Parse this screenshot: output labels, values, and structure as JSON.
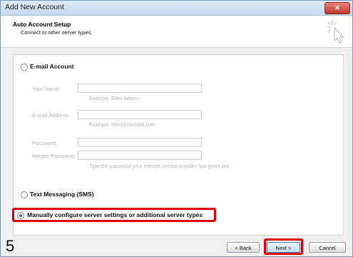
{
  "window": {
    "title": "Add New Account",
    "close_label": "✕"
  },
  "header": {
    "title": "Auto Account Setup",
    "subtitle": "Connect to other server types.",
    "icon": "wizard-cursor-icon"
  },
  "email_account": {
    "label": "E-mail Account",
    "name_label": "Your Name:",
    "name_hint": "Example: Ellen Adams",
    "email_label": "E-mail Address:",
    "email_hint": "Example: ellen@contoso.com",
    "password_label": "Password:",
    "retype_label": "Retype Password:",
    "password_hint": "Type the password your Internet service provider has given you."
  },
  "sms": {
    "label": "Text Messaging (SMS)"
  },
  "manual": {
    "label": "Manually configure server settings or additional server types",
    "selected": true
  },
  "buttons": {
    "back": "< Back",
    "next": "Next >",
    "cancel": "Cancel"
  },
  "step_number": "5",
  "colors": {
    "highlight": "#e00000",
    "accent": "#2a6ed4"
  }
}
